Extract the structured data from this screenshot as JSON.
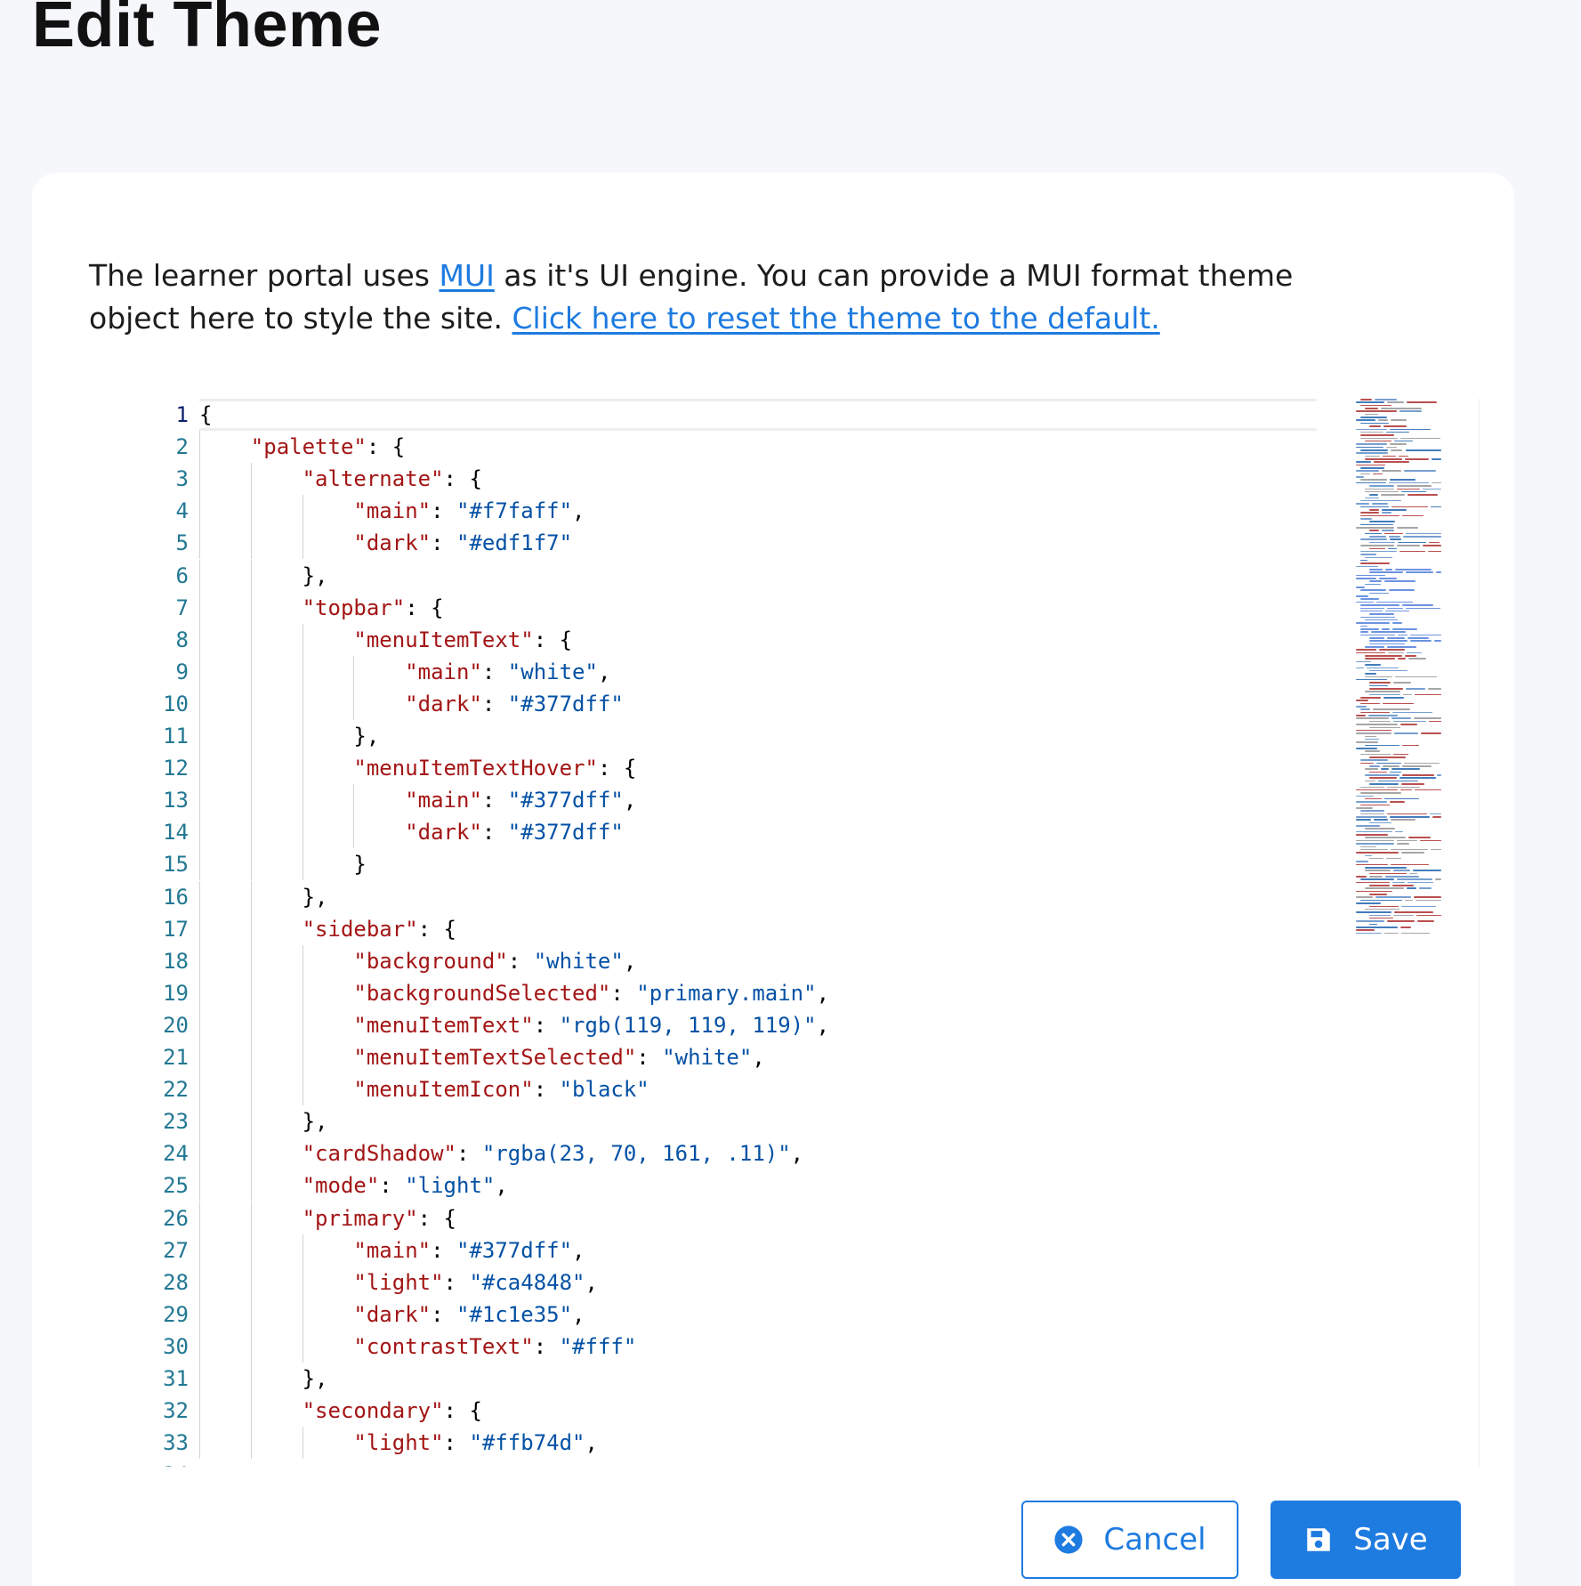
{
  "page": {
    "title": "Edit Theme"
  },
  "intro": {
    "text_before_link": "The learner portal uses ",
    "mui_link": "MUI",
    "text_after_link": " as it's UI engine. You can provide a MUI format theme object here to style the site. ",
    "reset_link": "Click here to reset the theme to the default."
  },
  "editor": {
    "active_line": 1,
    "lines": [
      [
        {
          "t": "{",
          "c": "p"
        }
      ],
      [
        {
          "t": "    ",
          "c": "p"
        },
        {
          "t": "\"palette\"",
          "c": "k"
        },
        {
          "t": ": {",
          "c": "p"
        }
      ],
      [
        {
          "t": "        ",
          "c": "p"
        },
        {
          "t": "\"alternate\"",
          "c": "k"
        },
        {
          "t": ": {",
          "c": "p"
        }
      ],
      [
        {
          "t": "            ",
          "c": "p"
        },
        {
          "t": "\"main\"",
          "c": "k"
        },
        {
          "t": ": ",
          "c": "p"
        },
        {
          "t": "\"#f7faff\"",
          "c": "s"
        },
        {
          "t": ",",
          "c": "p"
        }
      ],
      [
        {
          "t": "            ",
          "c": "p"
        },
        {
          "t": "\"dark\"",
          "c": "k"
        },
        {
          "t": ": ",
          "c": "p"
        },
        {
          "t": "\"#edf1f7\"",
          "c": "s"
        }
      ],
      [
        {
          "t": "        },",
          "c": "p"
        }
      ],
      [
        {
          "t": "        ",
          "c": "p"
        },
        {
          "t": "\"topbar\"",
          "c": "k"
        },
        {
          "t": ": {",
          "c": "p"
        }
      ],
      [
        {
          "t": "            ",
          "c": "p"
        },
        {
          "t": "\"menuItemText\"",
          "c": "k"
        },
        {
          "t": ": {",
          "c": "p"
        }
      ],
      [
        {
          "t": "                ",
          "c": "p"
        },
        {
          "t": "\"main\"",
          "c": "k"
        },
        {
          "t": ": ",
          "c": "p"
        },
        {
          "t": "\"white\"",
          "c": "s"
        },
        {
          "t": ",",
          "c": "p"
        }
      ],
      [
        {
          "t": "                ",
          "c": "p"
        },
        {
          "t": "\"dark\"",
          "c": "k"
        },
        {
          "t": ": ",
          "c": "p"
        },
        {
          "t": "\"#377dff\"",
          "c": "s"
        }
      ],
      [
        {
          "t": "            },",
          "c": "p"
        }
      ],
      [
        {
          "t": "            ",
          "c": "p"
        },
        {
          "t": "\"menuItemTextHover\"",
          "c": "k"
        },
        {
          "t": ": {",
          "c": "p"
        }
      ],
      [
        {
          "t": "                ",
          "c": "p"
        },
        {
          "t": "\"main\"",
          "c": "k"
        },
        {
          "t": ": ",
          "c": "p"
        },
        {
          "t": "\"#377dff\"",
          "c": "s"
        },
        {
          "t": ",",
          "c": "p"
        }
      ],
      [
        {
          "t": "                ",
          "c": "p"
        },
        {
          "t": "\"dark\"",
          "c": "k"
        },
        {
          "t": ": ",
          "c": "p"
        },
        {
          "t": "\"#377dff\"",
          "c": "s"
        }
      ],
      [
        {
          "t": "            }",
          "c": "p"
        }
      ],
      [
        {
          "t": "        },",
          "c": "p"
        }
      ],
      [
        {
          "t": "        ",
          "c": "p"
        },
        {
          "t": "\"sidebar\"",
          "c": "k"
        },
        {
          "t": ": {",
          "c": "p"
        }
      ],
      [
        {
          "t": "            ",
          "c": "p"
        },
        {
          "t": "\"background\"",
          "c": "k"
        },
        {
          "t": ": ",
          "c": "p"
        },
        {
          "t": "\"white\"",
          "c": "s"
        },
        {
          "t": ",",
          "c": "p"
        }
      ],
      [
        {
          "t": "            ",
          "c": "p"
        },
        {
          "t": "\"backgroundSelected\"",
          "c": "k"
        },
        {
          "t": ": ",
          "c": "p"
        },
        {
          "t": "\"primary.main\"",
          "c": "s"
        },
        {
          "t": ",",
          "c": "p"
        }
      ],
      [
        {
          "t": "            ",
          "c": "p"
        },
        {
          "t": "\"menuItemText\"",
          "c": "k"
        },
        {
          "t": ": ",
          "c": "p"
        },
        {
          "t": "\"rgb(119, 119, 119)\"",
          "c": "s"
        },
        {
          "t": ",",
          "c": "p"
        }
      ],
      [
        {
          "t": "            ",
          "c": "p"
        },
        {
          "t": "\"menuItemTextSelected\"",
          "c": "k"
        },
        {
          "t": ": ",
          "c": "p"
        },
        {
          "t": "\"white\"",
          "c": "s"
        },
        {
          "t": ",",
          "c": "p"
        }
      ],
      [
        {
          "t": "            ",
          "c": "p"
        },
        {
          "t": "\"menuItemIcon\"",
          "c": "k"
        },
        {
          "t": ": ",
          "c": "p"
        },
        {
          "t": "\"black\"",
          "c": "s"
        }
      ],
      [
        {
          "t": "        },",
          "c": "p"
        }
      ],
      [
        {
          "t": "        ",
          "c": "p"
        },
        {
          "t": "\"cardShadow\"",
          "c": "k"
        },
        {
          "t": ": ",
          "c": "p"
        },
        {
          "t": "\"rgba(23, 70, 161, .11)\"",
          "c": "s"
        },
        {
          "t": ",",
          "c": "p"
        }
      ],
      [
        {
          "t": "        ",
          "c": "p"
        },
        {
          "t": "\"mode\"",
          "c": "k"
        },
        {
          "t": ": ",
          "c": "p"
        },
        {
          "t": "\"light\"",
          "c": "s"
        },
        {
          "t": ",",
          "c": "p"
        }
      ],
      [
        {
          "t": "        ",
          "c": "p"
        },
        {
          "t": "\"primary\"",
          "c": "k"
        },
        {
          "t": ": {",
          "c": "p"
        }
      ],
      [
        {
          "t": "            ",
          "c": "p"
        },
        {
          "t": "\"main\"",
          "c": "k"
        },
        {
          "t": ": ",
          "c": "p"
        },
        {
          "t": "\"#377dff\"",
          "c": "s"
        },
        {
          "t": ",",
          "c": "p"
        }
      ],
      [
        {
          "t": "            ",
          "c": "p"
        },
        {
          "t": "\"light\"",
          "c": "k"
        },
        {
          "t": ": ",
          "c": "p"
        },
        {
          "t": "\"#ca4848\"",
          "c": "s"
        },
        {
          "t": ",",
          "c": "p"
        }
      ],
      [
        {
          "t": "            ",
          "c": "p"
        },
        {
          "t": "\"dark\"",
          "c": "k"
        },
        {
          "t": ": ",
          "c": "p"
        },
        {
          "t": "\"#1c1e35\"",
          "c": "s"
        },
        {
          "t": ",",
          "c": "p"
        }
      ],
      [
        {
          "t": "            ",
          "c": "p"
        },
        {
          "t": "\"contrastText\"",
          "c": "k"
        },
        {
          "t": ": ",
          "c": "p"
        },
        {
          "t": "\"#fff\"",
          "c": "s"
        }
      ],
      [
        {
          "t": "        },",
          "c": "p"
        }
      ],
      [
        {
          "t": "        ",
          "c": "p"
        },
        {
          "t": "\"secondary\"",
          "c": "k"
        },
        {
          "t": ": {",
          "c": "p"
        }
      ],
      [
        {
          "t": "            ",
          "c": "p"
        },
        {
          "t": "\"light\"",
          "c": "k"
        },
        {
          "t": ": ",
          "c": "p"
        },
        {
          "t": "\"#ffb74d\"",
          "c": "s"
        },
        {
          "t": ",",
          "c": "p"
        }
      ]
    ]
  },
  "buttons": {
    "cancel_label": "Cancel",
    "save_label": "Save"
  },
  "icons": {
    "cancel": "close-circle-icon",
    "save": "floppy-disk-icon"
  },
  "colors": {
    "accent": "#1e7be0",
    "key": "#a31515",
    "string": "#0451a5",
    "line_number": "#237893"
  }
}
